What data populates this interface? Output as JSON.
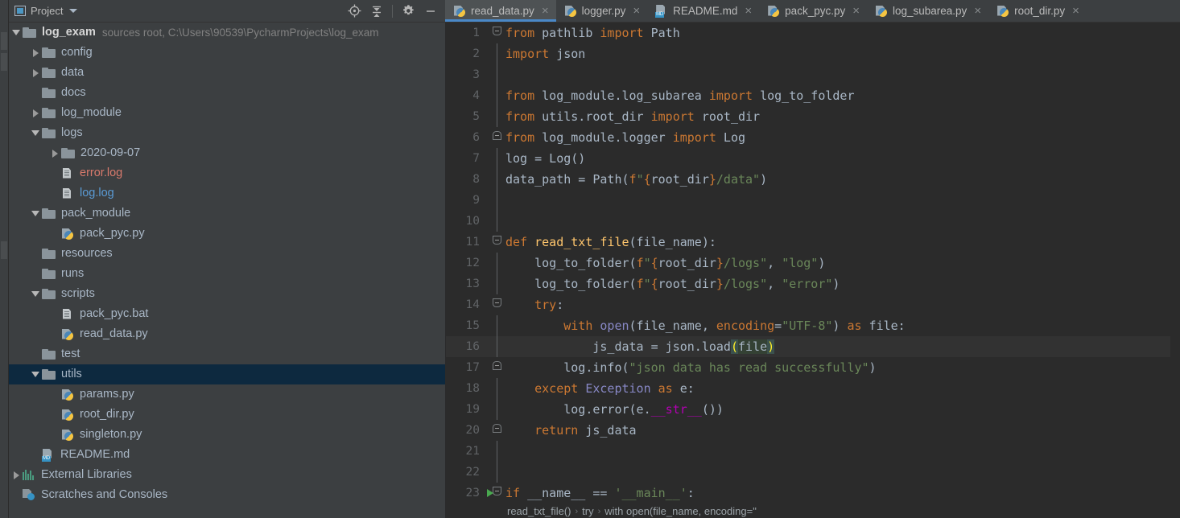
{
  "window": {
    "accent_blue": "#4a88c7",
    "selection_navy": "#0d293f",
    "editor_bg": "#2b2b2b",
    "panel_bg": "#3c3f41"
  },
  "project_panel": {
    "title": "Project",
    "title_icon": "project-window-icon",
    "caret_icon": "chevron-down-icon",
    "actions": [
      {
        "name": "locate-icon",
        "label": "Select Opened File"
      },
      {
        "name": "collapse-all-icon",
        "label": "Collapse All"
      },
      {
        "name": "gear-icon",
        "label": "Settings"
      },
      {
        "name": "minimize-icon",
        "label": "Hide"
      }
    ]
  },
  "tree": [
    {
      "depth": 0,
      "arrow": "down",
      "icon": "folder",
      "label": "log_exam",
      "bold": true,
      "sub": "sources root,  C:\\Users\\90539\\PycharmProjects\\log_exam",
      "selected": false
    },
    {
      "depth": 1,
      "arrow": "right",
      "icon": "folder",
      "label": "config",
      "selected": false
    },
    {
      "depth": 1,
      "arrow": "right",
      "icon": "folder",
      "label": "data",
      "selected": false
    },
    {
      "depth": 1,
      "arrow": "none",
      "icon": "folder",
      "label": "docs",
      "selected": false
    },
    {
      "depth": 1,
      "arrow": "right",
      "icon": "folder",
      "label": "log_module",
      "selected": false
    },
    {
      "depth": 1,
      "arrow": "down",
      "icon": "folder",
      "label": "logs",
      "selected": false
    },
    {
      "depth": 2,
      "arrow": "right",
      "icon": "folder",
      "label": "2020-09-07",
      "selected": false
    },
    {
      "depth": 2,
      "arrow": "none",
      "icon": "txt",
      "label": "error.log",
      "color": "err",
      "selected": false
    },
    {
      "depth": 2,
      "arrow": "none",
      "icon": "txt",
      "label": "log.log",
      "color": "logblue",
      "selected": false
    },
    {
      "depth": 1,
      "arrow": "down",
      "icon": "folder",
      "label": "pack_module",
      "selected": false
    },
    {
      "depth": 2,
      "arrow": "none",
      "icon": "py",
      "label": "pack_pyc.py",
      "selected": false
    },
    {
      "depth": 1,
      "arrow": "none",
      "icon": "folder",
      "label": "resources",
      "selected": false
    },
    {
      "depth": 1,
      "arrow": "none",
      "icon": "folder",
      "label": "runs",
      "selected": false
    },
    {
      "depth": 1,
      "arrow": "down",
      "icon": "folder",
      "label": "scripts",
      "selected": false
    },
    {
      "depth": 2,
      "arrow": "none",
      "icon": "txt",
      "label": "pack_pyc.bat",
      "selected": false
    },
    {
      "depth": 2,
      "arrow": "none",
      "icon": "py",
      "label": "read_data.py",
      "selected": false
    },
    {
      "depth": 1,
      "arrow": "none",
      "icon": "folder",
      "label": "test",
      "selected": false
    },
    {
      "depth": 1,
      "arrow": "down",
      "icon": "folder",
      "label": "utils",
      "selected": true
    },
    {
      "depth": 2,
      "arrow": "none",
      "icon": "py",
      "label": "params.py",
      "selected": false
    },
    {
      "depth": 2,
      "arrow": "none",
      "icon": "py",
      "label": "root_dir.py",
      "selected": false
    },
    {
      "depth": 2,
      "arrow": "none",
      "icon": "py",
      "label": "singleton.py",
      "selected": false
    },
    {
      "depth": 1,
      "arrow": "none",
      "icon": "md",
      "label": "README.md",
      "selected": false
    },
    {
      "depth": 0,
      "arrow": "right",
      "icon": "extlib",
      "label": "External Libraries",
      "selected": false
    },
    {
      "depth": 0,
      "arrow": "none",
      "icon": "scratch",
      "label": "Scratches and Consoles",
      "selected": false
    }
  ],
  "tabs": [
    {
      "label": "read_data.py",
      "icon": "py",
      "active": true,
      "close": "×"
    },
    {
      "label": "logger.py",
      "icon": "py",
      "active": false,
      "close": "×"
    },
    {
      "label": "README.md",
      "icon": "md",
      "active": false,
      "close": "×"
    },
    {
      "label": "pack_pyc.py",
      "icon": "py",
      "active": false,
      "close": "×"
    },
    {
      "label": "log_subarea.py",
      "icon": "py",
      "active": false,
      "close": "×"
    },
    {
      "label": "root_dir.py",
      "icon": "py",
      "active": false,
      "close": "×"
    }
  ],
  "editor": {
    "current_line": 16,
    "line_numbers": [
      "1",
      "2",
      "3",
      "4",
      "5",
      "6",
      "7",
      "8",
      "9",
      "10",
      "11",
      "12",
      "13",
      "14",
      "15",
      "16",
      "17",
      "18",
      "19",
      "20",
      "21",
      "22",
      "23"
    ],
    "code_lines": [
      "from pathlib import Path",
      "import json",
      "",
      "from log_module.log_subarea import log_to_folder",
      "from utils.root_dir import root_dir",
      "from log_module.logger import Log",
      "log = Log()",
      "data_path = Path(f\"{root_dir}/data\")",
      "",
      "",
      "def read_txt_file(file_name):",
      "    log_to_folder(f\"{root_dir}/logs\", \"log\")",
      "    log_to_folder(f\"{root_dir}/logs\", \"error\")",
      "    try:",
      "        with open(file_name, encoding=\"UTF-8\") as file:",
      "            js_data = json.load(file)",
      "        log.info(\"json data has read successfully\")",
      "    except Exception as e:",
      "        log.error(e.__str__())",
      "    return js_data",
      "",
      "",
      "if __name__ == '__main__':"
    ],
    "breadcrumb": [
      "read_txt_file()",
      "try",
      "with open(file_name, encoding=\""
    ],
    "breadcrumb_separator": "›",
    "run_marker_line": 23
  }
}
